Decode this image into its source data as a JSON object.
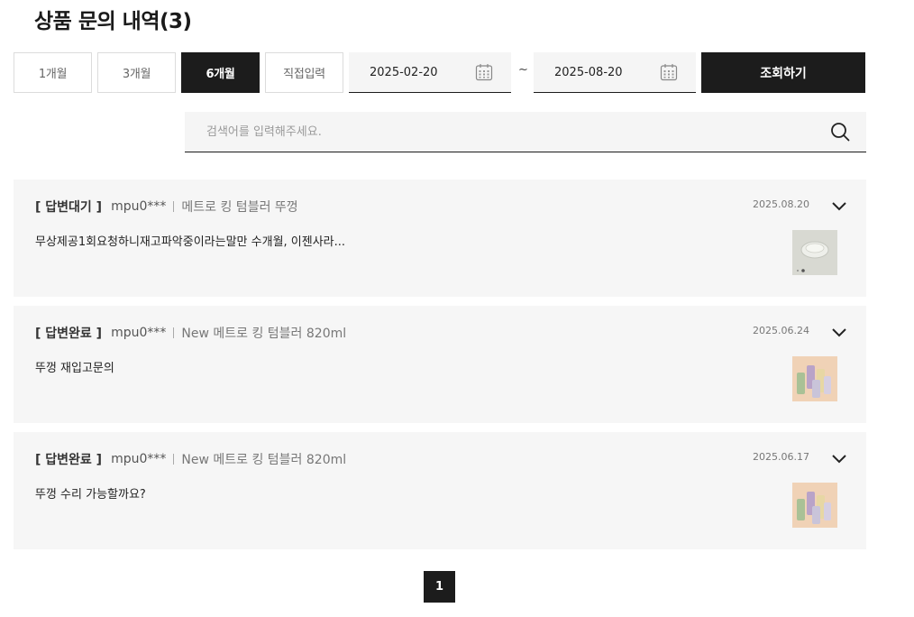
{
  "page": {
    "title": "상품 문의 내역(3)"
  },
  "filters": {
    "periods": [
      {
        "label": "1개월",
        "active": false
      },
      {
        "label": "3개월",
        "active": false
      },
      {
        "label": "6개월",
        "active": true
      },
      {
        "label": "직접입력",
        "active": false
      }
    ],
    "start_date": "2025-02-20",
    "separator": "~",
    "end_date": "2025-08-20",
    "calendar_icon": "calendar-icon",
    "submit_label": "조회하기"
  },
  "search": {
    "placeholder": "검색어를 입력해주세요.",
    "value": "",
    "icon": "search-icon"
  },
  "inquiries": [
    {
      "status": "[ 답변대기 ]",
      "writer": "mpu0***",
      "product": "메트로 킹 텀블러 뚜껑",
      "date": "2025.08.20",
      "content": "무상제공1회요청하니재고파악중이라는말만 수개월, 이젠사라...",
      "thumbnail": "tumbler-lid-thumbnail"
    },
    {
      "status": "[ 답변완료 ]",
      "writer": "mpu0***",
      "product": "New 메트로 킹 텀블러 820ml",
      "date": "2025.06.24",
      "content": "뚜껑 재입고문의",
      "thumbnail": "tumbler-set-thumbnail"
    },
    {
      "status": "[ 답변완료 ]",
      "writer": "mpu0***",
      "product": "New 메트로 킹 텀블러 820ml",
      "date": "2025.06.17",
      "content": "뚜껑 수리 가능할까요?",
      "thumbnail": "tumbler-set-thumbnail"
    }
  ],
  "pagination": {
    "current": "1"
  },
  "colors": {
    "accent": "#1c1c1c",
    "card_bg": "#f6f6f6",
    "input_bg": "#f5f5f5"
  }
}
